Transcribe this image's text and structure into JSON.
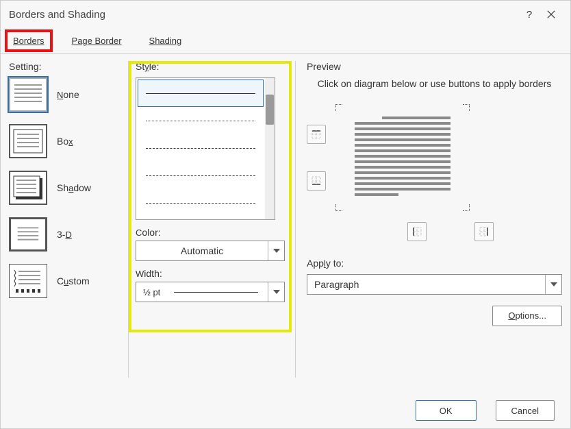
{
  "window": {
    "title": "Borders and Shading"
  },
  "tabs": {
    "borders": "Borders",
    "page_border": "Page Border",
    "shading": "Shading"
  },
  "setting": {
    "label": "Setting:",
    "items": [
      {
        "key": "none",
        "label": "None",
        "accel": "N",
        "selected": true,
        "thumb": "none"
      },
      {
        "key": "box",
        "label": "Box",
        "accel": "B",
        "selected": false,
        "thumb": "box"
      },
      {
        "key": "shadow",
        "label": "Shadow",
        "accel": "S",
        "selected": false,
        "thumb": "shadow"
      },
      {
        "key": "3d",
        "label": "3-D",
        "accel": "D",
        "selected": false,
        "thumb": "3d"
      },
      {
        "key": "custom",
        "label": "Custom",
        "accel": "C",
        "selected": false,
        "thumb": "custom"
      }
    ]
  },
  "style": {
    "label": "Style:",
    "selected_index": 0
  },
  "color": {
    "label": "Color:",
    "value": "Automatic"
  },
  "width": {
    "label": "Width:",
    "value": "½ pt"
  },
  "preview": {
    "label": "Preview",
    "instruction": "Click on diagram below or use buttons to apply borders"
  },
  "apply": {
    "label": "Apply to:",
    "value": "Paragraph"
  },
  "buttons": {
    "options": "Options...",
    "ok": "OK",
    "cancel": "Cancel"
  }
}
